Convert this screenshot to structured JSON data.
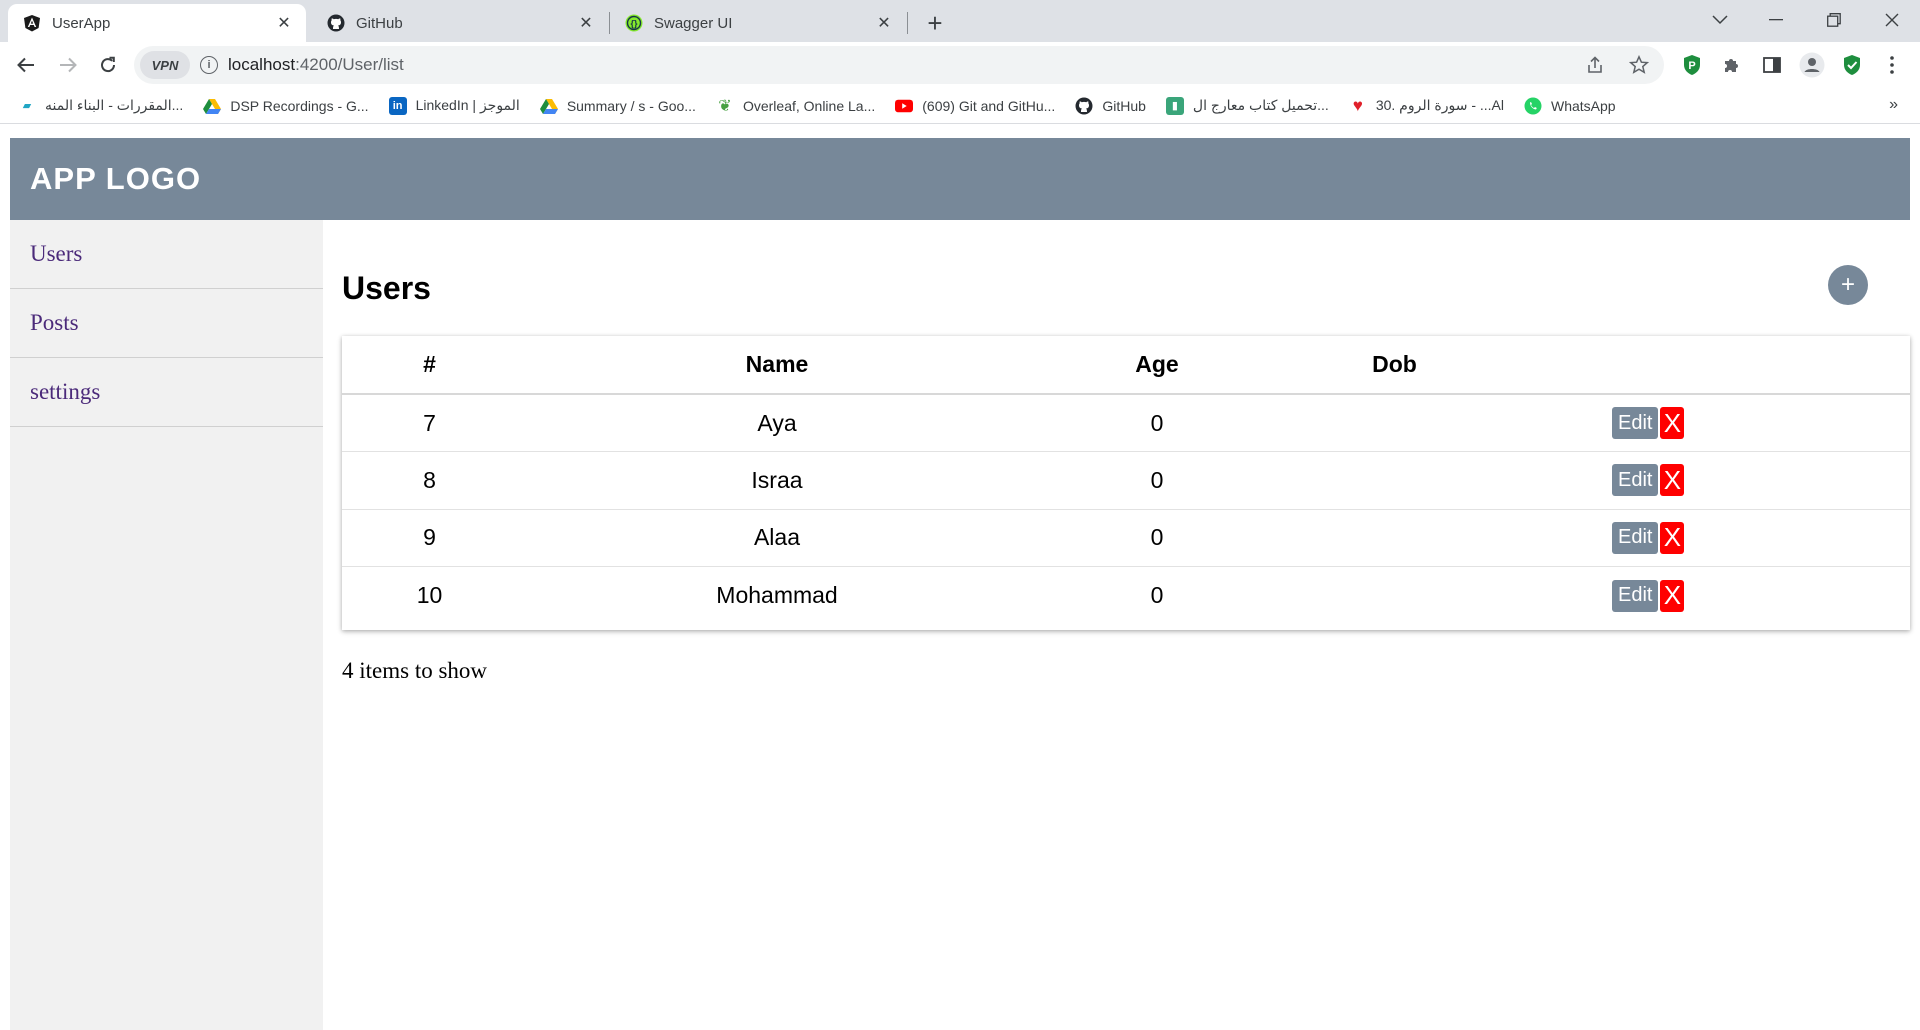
{
  "browser": {
    "tabs": [
      {
        "title": "UserApp",
        "icon": "angular-icon",
        "active": true
      },
      {
        "title": "GitHub",
        "icon": "github-icon",
        "active": false
      },
      {
        "title": "Swagger UI",
        "icon": "swagger-icon",
        "active": false
      }
    ],
    "vpn_label": "VPN",
    "url_host": "localhost",
    "url_path": ":4200/User/list",
    "bookmarks": [
      {
        "label": "المقررات - البناء المنه...",
        "icon": "edu-icon"
      },
      {
        "label": "DSP Recordings - G...",
        "icon": "google-drive-icon"
      },
      {
        "label": "LinkedIn | الموجز",
        "icon": "linkedin-icon"
      },
      {
        "label": "Summary / s - Goo...",
        "icon": "google-drive-icon"
      },
      {
        "label": "Overleaf, Online La...",
        "icon": "overleaf-icon"
      },
      {
        "label": "(609) Git and GitHu...",
        "icon": "youtube-icon"
      },
      {
        "label": "GitHub",
        "icon": "github-icon"
      },
      {
        "label": "تحميل كتاب معارج ال...",
        "icon": "book-icon"
      },
      {
        "label": "30. سورة الروم - ...Al",
        "icon": "heart-icon"
      },
      {
        "label": "WhatsApp",
        "icon": "whatsapp-icon"
      }
    ],
    "bookmarks_more": "»"
  },
  "app": {
    "logo": "APP LOGO",
    "sidebar": [
      {
        "label": "Users"
      },
      {
        "label": "Posts"
      },
      {
        "label": "settings"
      }
    ],
    "page_title": "Users",
    "add_button": "+",
    "table": {
      "headers": [
        "#",
        "Name",
        "Age",
        "Dob"
      ],
      "rows": [
        {
          "id": "7",
          "name": "Aya",
          "age": "0",
          "dob": ""
        },
        {
          "id": "8",
          "name": "Israa",
          "age": "0",
          "dob": ""
        },
        {
          "id": "9",
          "name": "Alaa",
          "age": "0",
          "dob": ""
        },
        {
          "id": "10",
          "name": "Mohammad",
          "age": "0",
          "dob": ""
        }
      ],
      "edit_label": "Edit",
      "delete_label": "X"
    },
    "footer_count": "4 items to show"
  },
  "colors": {
    "accent": "#778899",
    "danger": "#ff0000",
    "sidebar_bg": "#f1f1f1",
    "link": "#4b2a7a"
  }
}
